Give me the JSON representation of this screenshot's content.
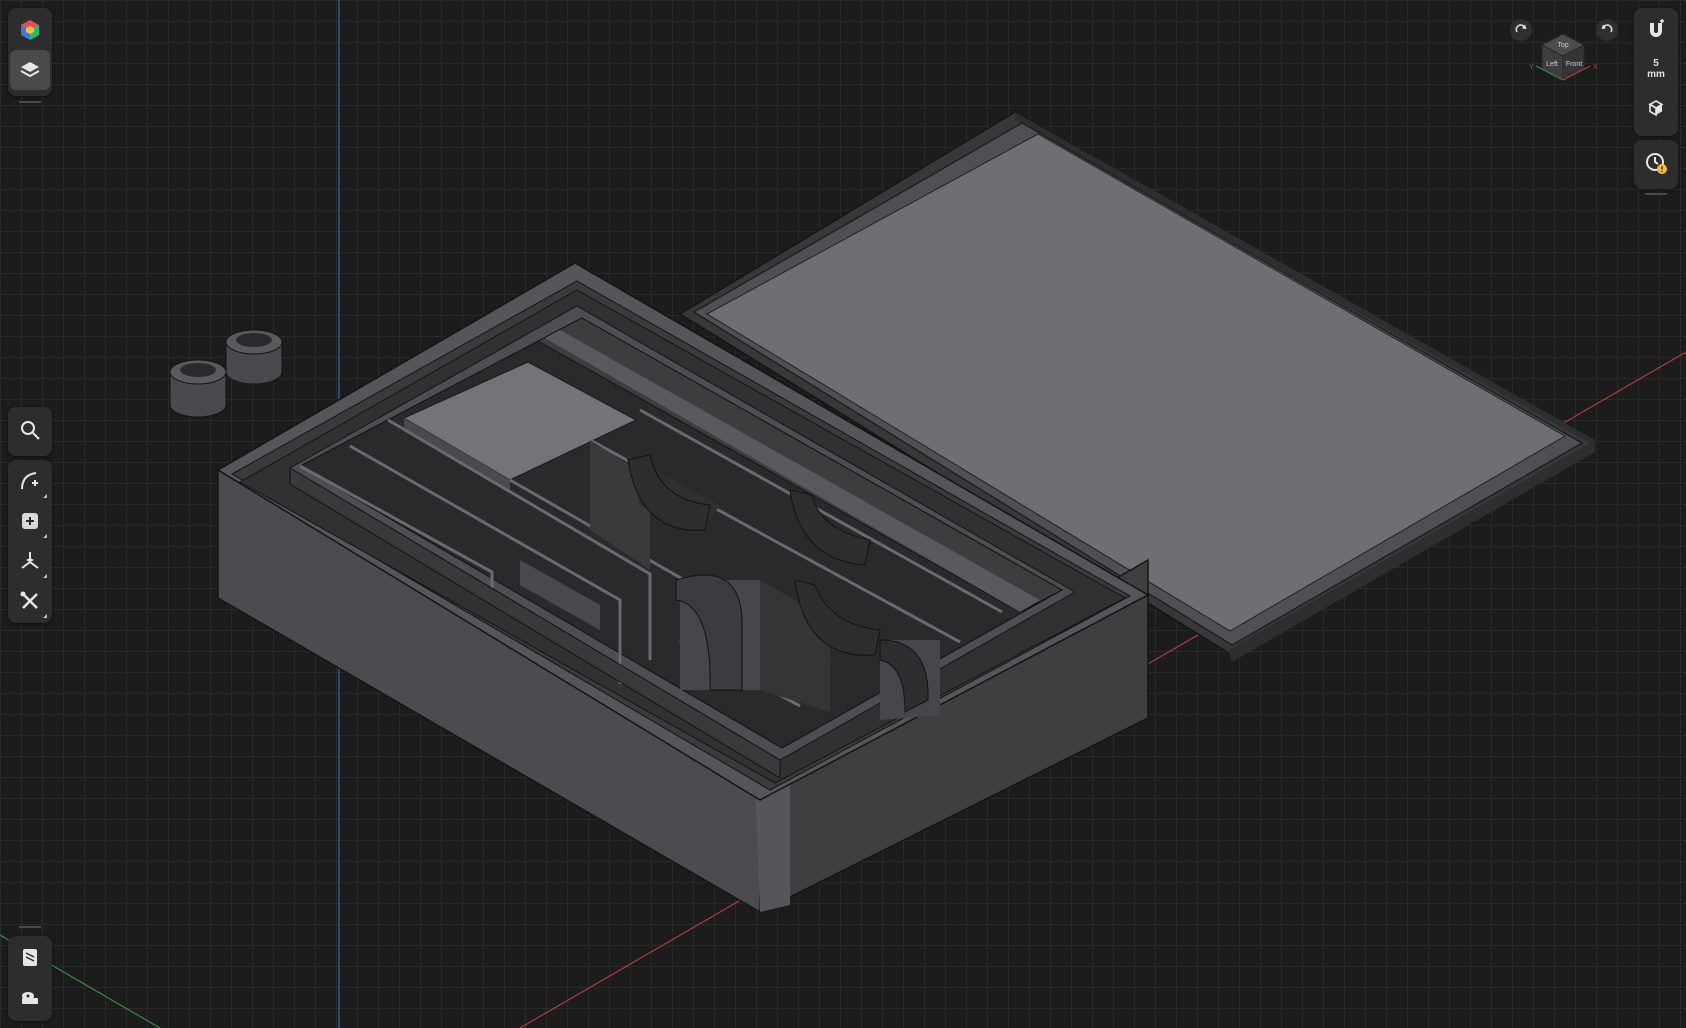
{
  "viewcube": {
    "top_label": "Top",
    "left_label": "Left",
    "front_label": "Front",
    "axis_x": "X",
    "axis_y": "Y"
  },
  "left_toolbar": {
    "top_group": [
      "app-logo-icon",
      "layers-icon"
    ],
    "tools": [
      "search-icon",
      "sketch-icon",
      "add-primitive-icon",
      "transform-icon",
      "tools-icon"
    ],
    "bottom_group": [
      "material-icon",
      "measure-icon"
    ]
  },
  "right_toolbar": {
    "snap_icon": "magnet-icon",
    "snap_value": "5",
    "snap_unit": "mm",
    "view_icon": "cube-view-icon",
    "history_icon": "history-warning-icon"
  },
  "colors": {
    "background": "#1c1c1d",
    "grid": "#2a2a2b",
    "model": "#5d5d61",
    "axis_x": "#b03a3a",
    "axis_y": "#3a8a3a",
    "axis_z": "#3a6ab0",
    "warning": "#f2c12e"
  }
}
